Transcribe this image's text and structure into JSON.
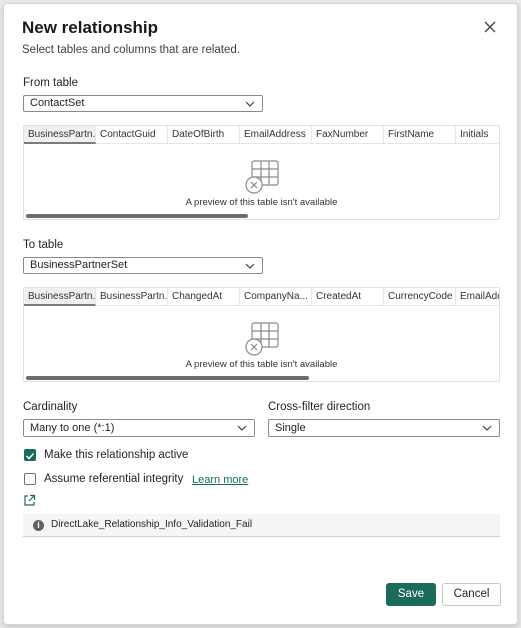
{
  "dialog": {
    "title": "New relationship",
    "subtitle": "Select tables and columns that are related."
  },
  "from_table": {
    "label": "From table",
    "selected": "ContactSet",
    "columns": [
      "BusinessPartn...",
      "ContactGuid",
      "DateOfBirth",
      "EmailAddress",
      "FaxNumber",
      "FirstName",
      "Initials"
    ],
    "preview_message": "A preview of this table isn't available"
  },
  "to_table": {
    "label": "To table",
    "selected": "BusinessPartnerSet",
    "columns": [
      "BusinessPartn...",
      "BusinessPartn...",
      "ChangedAt",
      "CompanyNa...",
      "CreatedAt",
      "CurrencyCode",
      "EmailAdd"
    ],
    "preview_message": "A preview of this table isn't available"
  },
  "cardinality": {
    "label": "Cardinality",
    "selected": "Many to one (*:1)"
  },
  "cross_filter": {
    "label": "Cross-filter direction",
    "selected": "Single"
  },
  "options": {
    "make_active": {
      "label": "Make this relationship active",
      "checked": true
    },
    "referential_integrity": {
      "label": "Assume referential integrity",
      "checked": false
    },
    "learn_more": "Learn more"
  },
  "info_bar": {
    "message": "DirectLake_Relationship_Info_Validation_Fail"
  },
  "buttons": {
    "save": "Save",
    "cancel": "Cancel"
  },
  "colors": {
    "accent": "#1b6b5a",
    "link": "#0f6e5c"
  },
  "icons": [
    "close-icon",
    "chevron-down-icon",
    "table-unavailable-icon",
    "checkmark-icon",
    "open-external-icon",
    "info-icon"
  ]
}
